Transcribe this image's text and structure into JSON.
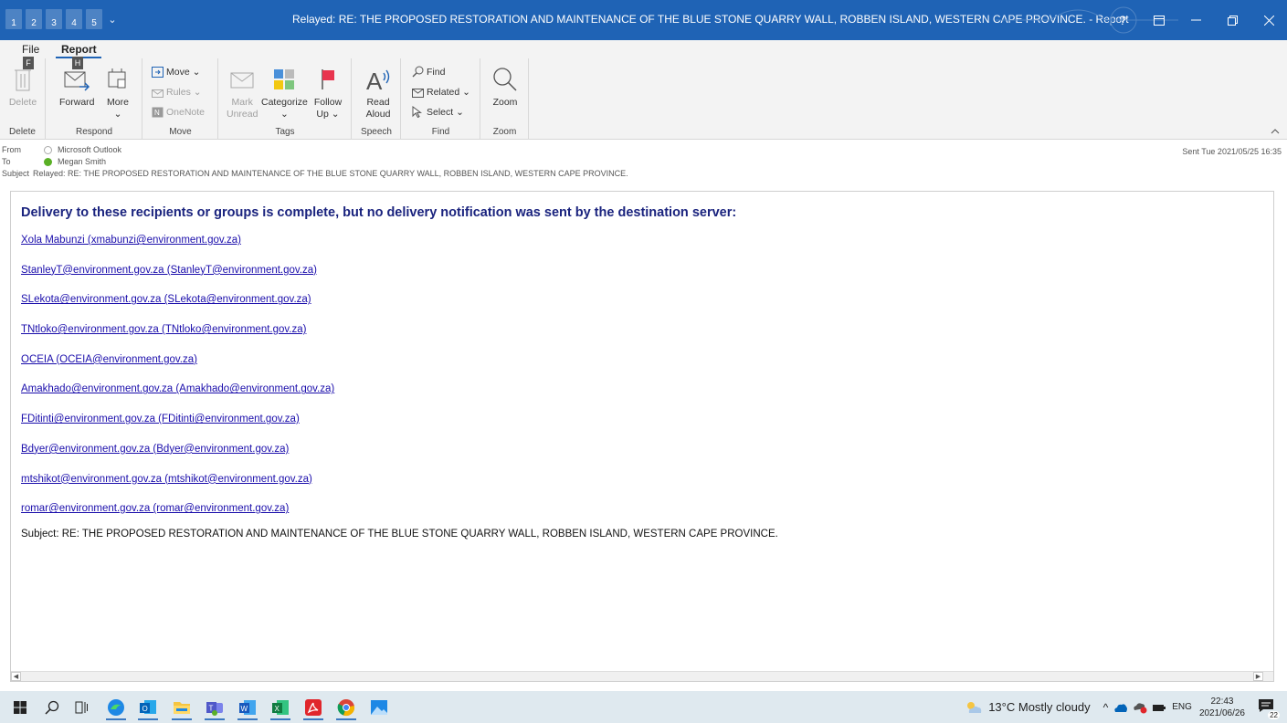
{
  "window": {
    "title": "Relayed: RE: THE PROPOSED RESTORATION AND MAINTENANCE OF THE BLUE STONE QUARRY WALL, ROBBEN ISLAND, WESTERN CAPE PROVINCE.  - Report",
    "help_label": "?",
    "qat_keys": [
      "1",
      "2",
      "3",
      "4",
      "5"
    ],
    "accent_color": "#1f63b5"
  },
  "tabs": {
    "file": "File",
    "report": "Report",
    "file_keytip": "F",
    "report_keytip": "H"
  },
  "ribbon": {
    "groups": {
      "delete": "Delete",
      "respond": "Respond",
      "move": "Move",
      "tags": "Tags",
      "speech": "Speech",
      "find": "Find",
      "zoom": "Zoom"
    },
    "delete_btn": "Delete",
    "forward_btn": "Forward",
    "more_btn": "More",
    "more_caret": "⌄",
    "move_btn": "Move ⌄",
    "rules_btn": "Rules ⌄",
    "onenote_btn": "OneNote",
    "mark_unread_1": "Mark",
    "mark_unread_2": "Unread",
    "categorize_1": "Categorize",
    "categorize_2": "⌄",
    "follow_up_1": "Follow",
    "follow_up_2": "Up ⌄",
    "read_aloud_1": "Read",
    "read_aloud_2": "Aloud",
    "find_btn": "Find",
    "related_btn": "Related ⌄",
    "select_btn": "Select ⌄",
    "zoom_btn": "Zoom"
  },
  "header": {
    "from_label": "From",
    "from_value": "Microsoft Outlook",
    "to_label": "To",
    "to_value": "Megan Smith",
    "subject_label": "Subject",
    "subject_value": "Relayed: RE: THE PROPOSED RESTORATION AND MAINTENANCE OF THE BLUE STONE QUARRY WALL, ROBBEN ISLAND, WESTERN CAPE PROVINCE.",
    "sent": "Sent   Tue 2021/05/25 16:35"
  },
  "body": {
    "heading": "Delivery to these recipients or groups is complete, but no delivery notification was sent by the destination server:",
    "recipients": [
      "Xola Mabunzi (xmabunzi@environment.gov.za)",
      "StanleyT@environment.gov.za (StanleyT@environment.gov.za)",
      "SLekota@environment.gov.za (SLekota@environment.gov.za)",
      "TNtloko@environment.gov.za (TNtloko@environment.gov.za)",
      "OCEIA (OCEIA@environment.gov.za)",
      "Amakhado@environment.gov.za (Amakhado@environment.gov.za)",
      "FDitinti@environment.gov.za (FDitinti@environment.gov.za)",
      "Bdyer@environment.gov.za (Bdyer@environment.gov.za)",
      "mtshikot@environment.gov.za (mtshikot@environment.gov.za)",
      "romar@environment.gov.za (romar@environment.gov.za)"
    ],
    "subject_line": "Subject: RE: THE PROPOSED RESTORATION AND MAINTENANCE OF THE BLUE STONE QUARRY WALL, ROBBEN ISLAND, WESTERN CAPE PROVINCE."
  },
  "taskbar": {
    "weather": "13°C  Mostly cloudy",
    "language": "ENG",
    "time": "22:43",
    "date": "2021/06/26",
    "notification_count": "22"
  }
}
